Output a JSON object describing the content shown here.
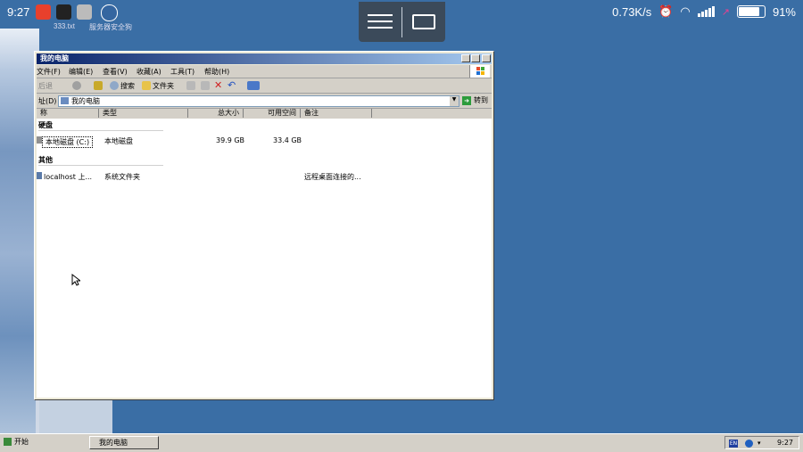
{
  "statusbar": {
    "time": "9:27",
    "network_speed": "0.73K/s",
    "battery_percent": "91%",
    "battery_level": 0.91
  },
  "desktop": {
    "labels": [
      "333.txt",
      "服务器安全狗"
    ]
  },
  "window": {
    "title": "我的电脑",
    "menu": [
      "文件(F)",
      "编辑(E)",
      "查看(V)",
      "收藏(A)",
      "工具(T)",
      "帮助(H)"
    ],
    "toolbar": {
      "back": "后退",
      "search": "搜索",
      "folders": "文件夹"
    },
    "address": {
      "label": "址(D)",
      "value": "我的电脑",
      "go": "转到"
    },
    "columns": [
      "称",
      "类型",
      "总大小",
      "可用空间",
      "备注"
    ],
    "groups": [
      {
        "name": "硬盘",
        "items": [
          {
            "name": "本地磁盘 (C:)",
            "type": "本地磁盘",
            "total": "39.9 GB",
            "free": "33.4 GB",
            "note": ""
          }
        ]
      },
      {
        "name": "其他",
        "items": [
          {
            "name": "localhost 上...",
            "type": "系统文件夹",
            "total": "",
            "free": "",
            "note": "远程桌面连接的..."
          }
        ]
      }
    ]
  },
  "taskbar": {
    "start": "开始",
    "task": "我的电脑",
    "tray_lang": "EN",
    "clock": "9:27"
  },
  "colors": {
    "desktop": "#3a6ea5",
    "title_start": "#0a246a",
    "title_end": "#a6caf0"
  }
}
